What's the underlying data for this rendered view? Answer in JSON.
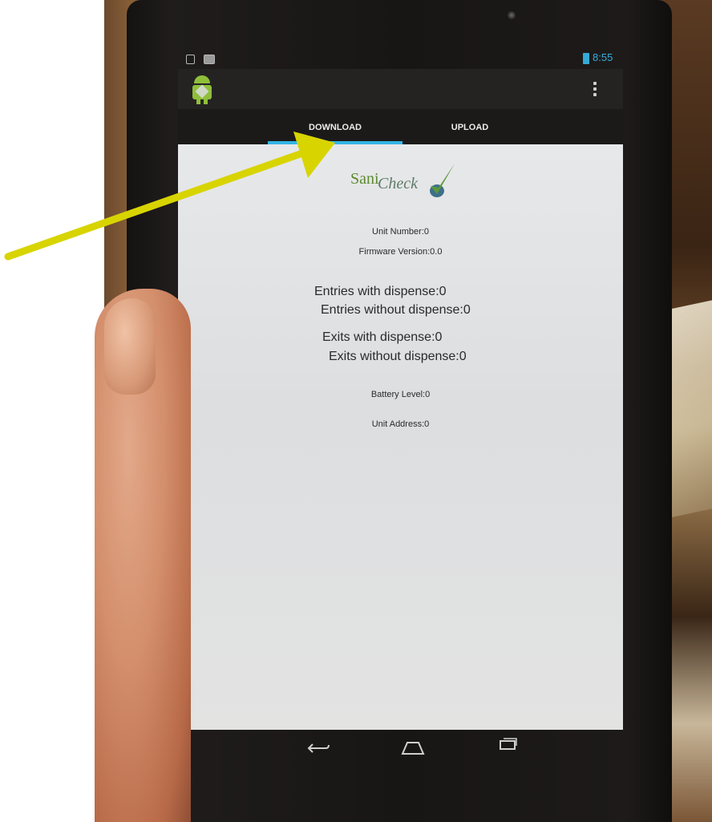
{
  "status_bar": {
    "time": "8:55"
  },
  "tabs": [
    {
      "label": "DOWNLOAD",
      "selected": true
    },
    {
      "label": "UPLOAD",
      "selected": false
    }
  ],
  "logo": {
    "part1": "Sani",
    "part2": "Check"
  },
  "fields": {
    "unit_number": "Unit Number:0",
    "firmware_version": "Firmware Version:0.0",
    "entries_with_dispense": "Entries with dispense:0",
    "entries_without_dispense": "Entries without dispense:0",
    "exits_with_dispense": "Exits with dispense:0",
    "exits_without_dispense": "Exits without dispense:0",
    "battery_level": "Battery Level:0",
    "unit_address": "Unit Address:0"
  },
  "icons": {
    "app": "android-robot-icon",
    "overflow": "overflow-menu-icon",
    "back": "back-icon",
    "home": "home-icon",
    "recents": "recent-apps-icon",
    "battery": "battery-icon"
  },
  "colors": {
    "tab_indicator": "#33b5e5",
    "clock": "#37aee0",
    "annotation_arrow": "#d8d400",
    "logo_green": "#5a8a2c"
  }
}
